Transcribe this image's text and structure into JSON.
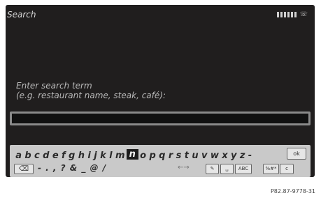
{
  "header": {
    "title": "Search",
    "signal_icon": "signal-bars-icon",
    "phone_icon": "phone-icon"
  },
  "prompt": {
    "line1": "Enter search term",
    "line2": "(e.g. restaurant name, steak, café):"
  },
  "search": {
    "value": ""
  },
  "keyboard": {
    "row1_before": [
      "a",
      "b",
      "c",
      "d",
      "e",
      "f",
      "g",
      "h",
      "i",
      "j",
      "k",
      "l",
      "m"
    ],
    "selected_key": "n",
    "row1_after": [
      "o",
      "p",
      "q",
      "r",
      "s",
      "t",
      "u",
      "v",
      "w",
      "x",
      "y",
      "z",
      "-"
    ],
    "ok_label": "ok",
    "backspace_icon": "backspace-icon",
    "symbols": "- . , ? & _ @ /",
    "arrows": "←→",
    "pencil_icon": "pencil-icon",
    "space_icon": "space-icon",
    "abc_label": "ABC",
    "ampm_label": "%#*",
    "c_label": "c"
  },
  "footer": {
    "code": "P82.87-9778-31"
  }
}
